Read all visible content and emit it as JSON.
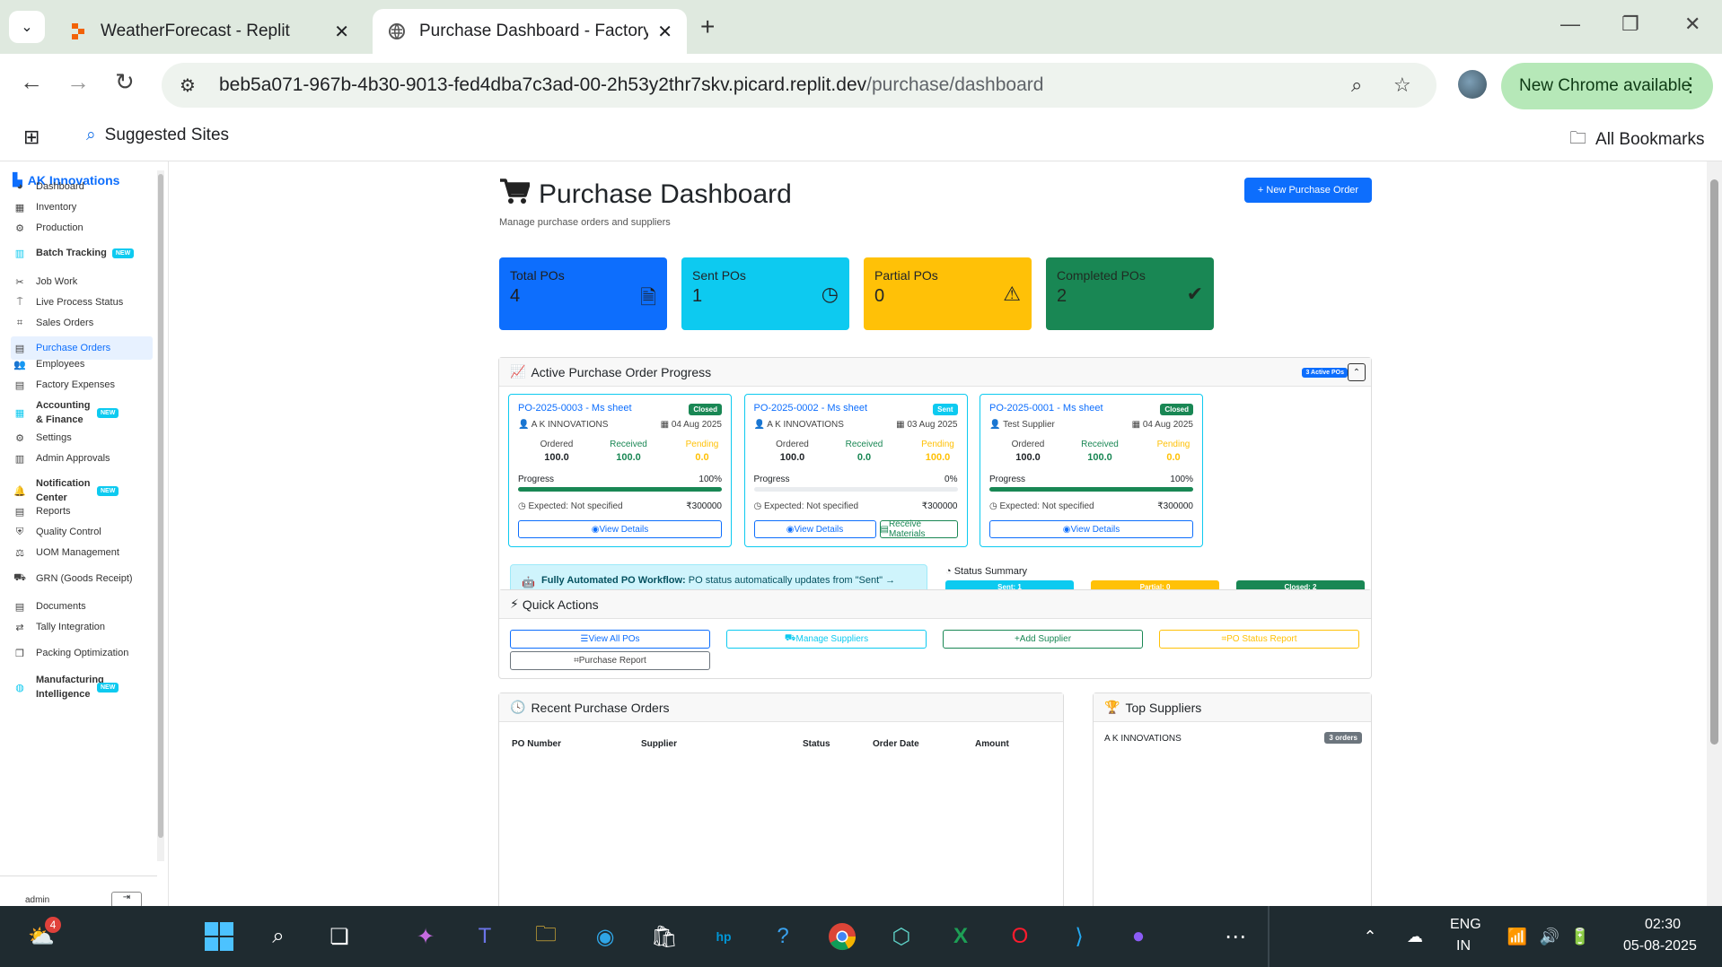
{
  "browser": {
    "tabs": [
      {
        "title": "WeatherForecast - Replit",
        "active": false
      },
      {
        "title": "Purchase Dashboard - Factory M",
        "active": true
      }
    ],
    "url_host": "beb5a071-967b-4b30-9013-fed4dba7c3ad-00-2h53y2thr7skv.picard.replit.dev",
    "url_path": "/purchase/dashboard",
    "update_label": "New Chrome available",
    "bookmarks": {
      "suggested": "Suggested Sites",
      "all": "All Bookmarks"
    }
  },
  "sidebar": {
    "brand": "AK Innovations",
    "new_badge": "NEW",
    "items": [
      {
        "label": "Dashboard",
        "icon": "gauge-icon"
      },
      {
        "label": "Inventory",
        "icon": "boxes-icon"
      },
      {
        "label": "Production",
        "icon": "cogs-icon"
      },
      {
        "label": "Batch Tracking",
        "icon": "barcode-icon",
        "badge": true,
        "bold": true
      },
      {
        "label": "Job Work",
        "icon": "tools-icon"
      },
      {
        "label": "Live Process Status",
        "icon": "tower-icon"
      },
      {
        "label": "Sales Orders",
        "icon": "chart-icon"
      },
      {
        "label": "Purchase Orders",
        "icon": "file-icon",
        "active": true
      },
      {
        "label": "Employees",
        "icon": "users-icon"
      },
      {
        "label": "Factory Expenses",
        "icon": "receipt-icon"
      },
      {
        "label": "Accounting & Finance",
        "icon": "calculator-icon",
        "badge": true,
        "bold": true
      },
      {
        "label": "Settings",
        "icon": "gear-icon"
      },
      {
        "label": "Admin Approvals",
        "icon": "clipboard-icon"
      },
      {
        "label": "Notification Center",
        "icon": "bell-icon",
        "badge": true,
        "bold": true
      },
      {
        "label": "Reports",
        "icon": "report-icon"
      },
      {
        "label": "Quality Control",
        "icon": "shield-icon"
      },
      {
        "label": "UOM Management",
        "icon": "balance-icon"
      },
      {
        "label": "GRN (Goods Receipt)",
        "icon": "truck-icon"
      },
      {
        "label": "Documents",
        "icon": "document-icon"
      },
      {
        "label": "Tally Integration",
        "icon": "exchange-icon"
      },
      {
        "label": "Packing Optimization",
        "icon": "cube-icon"
      },
      {
        "label": "Manufacturing Intelligence",
        "icon": "brain-icon",
        "badge": true,
        "bold": true
      }
    ],
    "user": "admin"
  },
  "header": {
    "title": "Purchase Dashboard",
    "subtitle": "Manage purchase orders and suppliers",
    "new_po_button": "+ New Purchase Order"
  },
  "stats": [
    {
      "label": "Total POs",
      "value": "4",
      "color": "#0d6efd",
      "icon": "file-icon"
    },
    {
      "label": "Sent POs",
      "value": "1",
      "color": "#0dcaf0",
      "icon": "clock-icon"
    },
    {
      "label": "Partial POs",
      "value": "0",
      "color": "#ffc107",
      "icon": "warning-icon"
    },
    {
      "label": "Completed POs",
      "value": "2",
      "color": "#198754",
      "icon": "check-circle-icon"
    }
  ],
  "progress_panel": {
    "title": "Active Purchase Order Progress",
    "badge": "3 Active POs",
    "col_labels": {
      "ordered": "Ordered",
      "received": "Received",
      "pending": "Pending",
      "progress": "Progress",
      "view": "View Details",
      "receive": "Receive Materials"
    },
    "cards": [
      {
        "title": "PO-2025-0003 - Ms sheet",
        "status": "Closed",
        "status_color": "#198754",
        "supplier": "A K INNOVATIONS",
        "date": "04 Aug 2025",
        "ordered": "100.0",
        "received": "100.0",
        "pending": "0.0",
        "progress": 100,
        "progress_label": "100%",
        "expected": "Expected: Not specified",
        "amount": "₹300000",
        "receive": false
      },
      {
        "title": "PO-2025-0002 - Ms sheet",
        "status": "Sent",
        "status_color": "#0dcaf0",
        "supplier": "A K INNOVATIONS",
        "date": "03 Aug 2025",
        "ordered": "100.0",
        "received": "0.0",
        "pending": "100.0",
        "progress": 0,
        "progress_label": "0%",
        "expected": "Expected: Not specified",
        "amount": "₹300000",
        "receive": true
      },
      {
        "title": "PO-2025-0001 - Ms sheet",
        "status": "Closed",
        "status_color": "#198754",
        "supplier": "Test Supplier",
        "date": "04 Aug 2025",
        "ordered": "100.0",
        "received": "100.0",
        "pending": "0.0",
        "progress": 100,
        "progress_label": "100%",
        "expected": "Expected: Not specified",
        "amount": "₹300000",
        "receive": false
      }
    ],
    "automation": {
      "bold": "Fully Automated PO Workflow:",
      "text": " PO status automatically updates from \"Sent\" → \"Partial\" → \"Closed\" based on GRN material receipts. Only manual action is cancellation for supplier issues."
    },
    "status_summary": {
      "title": "Status Summary",
      "pills": [
        {
          "label": "Sent: 1",
          "color": "#0dcaf0"
        },
        {
          "label": "Partial: 0",
          "color": "#ffc107"
        },
        {
          "label": "Closed: 2",
          "color": "#198754"
        }
      ]
    }
  },
  "quick_actions": {
    "title": "Quick Actions",
    "buttons": [
      {
        "label": "View All POs",
        "color": "#0d6efd"
      },
      {
        "label": "Manage Suppliers",
        "color": "#0dcaf0"
      },
      {
        "label": "Add Supplier",
        "color": "#198754"
      },
      {
        "label": "PO Status Report",
        "color": "#ffc107"
      },
      {
        "label": "Purchase Report",
        "color": "#6c757d"
      }
    ]
  },
  "recent_orders": {
    "title": "Recent Purchase Orders",
    "columns": [
      "PO Number",
      "Supplier",
      "Status",
      "Order Date",
      "Amount"
    ]
  },
  "top_suppliers": {
    "title": "Top Suppliers",
    "first": {
      "name": "A K INNOVATIONS",
      "badge": "3 orders"
    }
  },
  "taskbar": {
    "weather_badge": "4",
    "lang": "ENG",
    "region": "IN",
    "time": "02:30",
    "date": "05-08-2025"
  }
}
